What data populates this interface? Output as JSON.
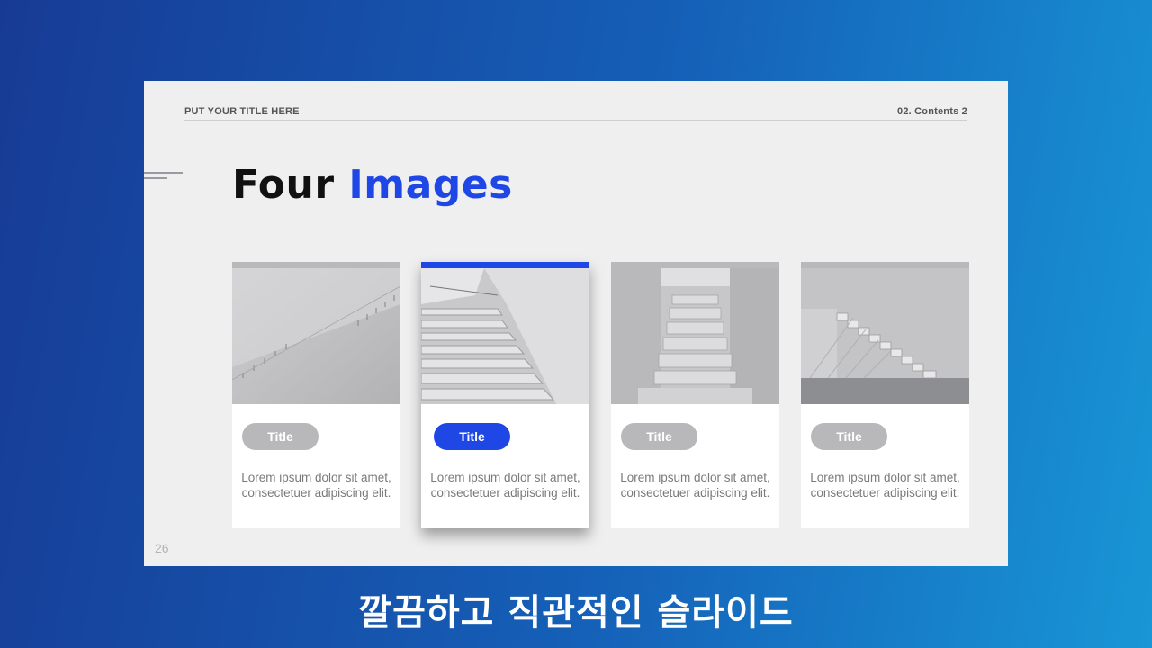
{
  "slide": {
    "header_left": "PUT YOUR TITLE HERE",
    "header_right": "02. Contents 2",
    "title_main": "Four",
    "title_accent": "Images",
    "page_number": "26"
  },
  "cards": [
    {
      "title": "Title",
      "body": "Lorem ipsum dolor sit amet, consectetuer adipiscing elit.",
      "image": "white-wall-stairs-photo",
      "active": false
    },
    {
      "title": "Title",
      "body": "Lorem ipsum dolor sit amet, consectetuer adipiscing elit.",
      "image": "white-staircase-photo",
      "active": true
    },
    {
      "title": "Title",
      "body": "Lorem ipsum dolor sit amet, consectetuer adipiscing elit.",
      "image": "corridor-stairs-photo",
      "active": false
    },
    {
      "title": "Title",
      "body": "Lorem ipsum dolor sit amet, consectetuer adipiscing elit.",
      "image": "floating-stairs-photo",
      "active": false
    }
  ],
  "caption": "깔끔하고 직관적인 슬라이드",
  "colors": {
    "accent": "#1f47e6",
    "inactive_pill": "#b8b8ba",
    "slide_bg": "#efeff0",
    "bg_gradient_start": "#173b95",
    "bg_gradient_end": "#1896d6"
  }
}
